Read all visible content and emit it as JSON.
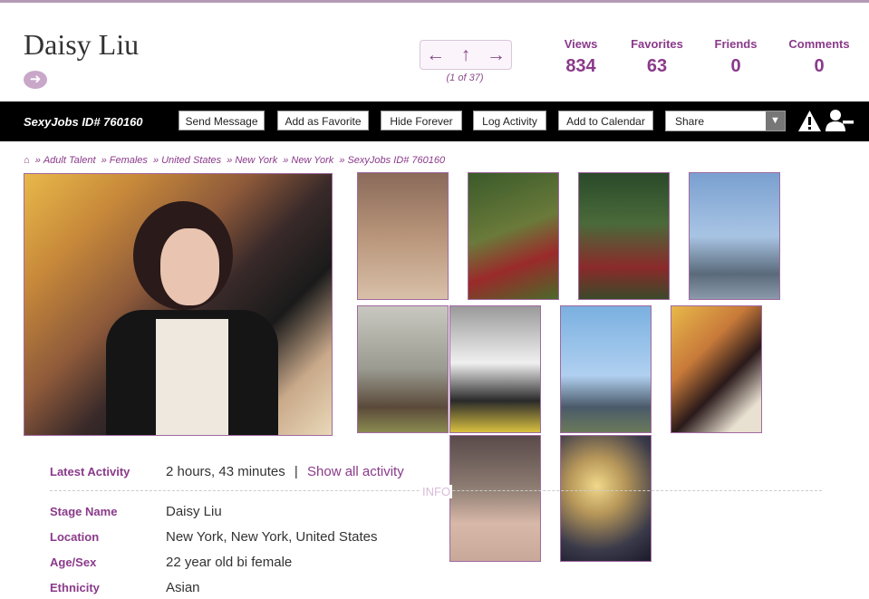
{
  "profile_name": "Daisy Liu",
  "nav": {
    "count": "(1 of 37)"
  },
  "stats": [
    {
      "label": "Views",
      "value": "834"
    },
    {
      "label": "Favorites",
      "value": "63"
    },
    {
      "label": "Friends",
      "value": "0"
    },
    {
      "label": "Comments",
      "value": "0"
    }
  ],
  "toolbar": {
    "id_text": "SexyJobs ID# 760160",
    "buttons": [
      "Send Message",
      "Add as Favorite",
      "Hide Forever",
      "Log Activity",
      "Add to Calendar"
    ],
    "share_label": "Share"
  },
  "breadcrumb": [
    "Adult Talent",
    "Females",
    "United States",
    "New York",
    "New York",
    "SexyJobs ID# 760160"
  ],
  "details": {
    "latest_activity_label": "Latest Activity",
    "latest_activity_value": "2 hours, 43 minutes",
    "latest_activity_sep": "|",
    "show_all_link": "Show all activity",
    "info_tag": "INFO",
    "stage_name_label": "Stage Name",
    "stage_name_value": "Daisy Liu",
    "location_label": "Location",
    "location_value": "New York, New York, United States",
    "age_sex_label": "Age/Sex",
    "age_sex_value": "22 year old bi female",
    "ethnicity_label": "Ethnicity",
    "ethnicity_value": "Asian"
  },
  "colors": {
    "accent": "#8a3a8a",
    "toolbar_bg": "#000000",
    "border": "#a06aa0"
  }
}
